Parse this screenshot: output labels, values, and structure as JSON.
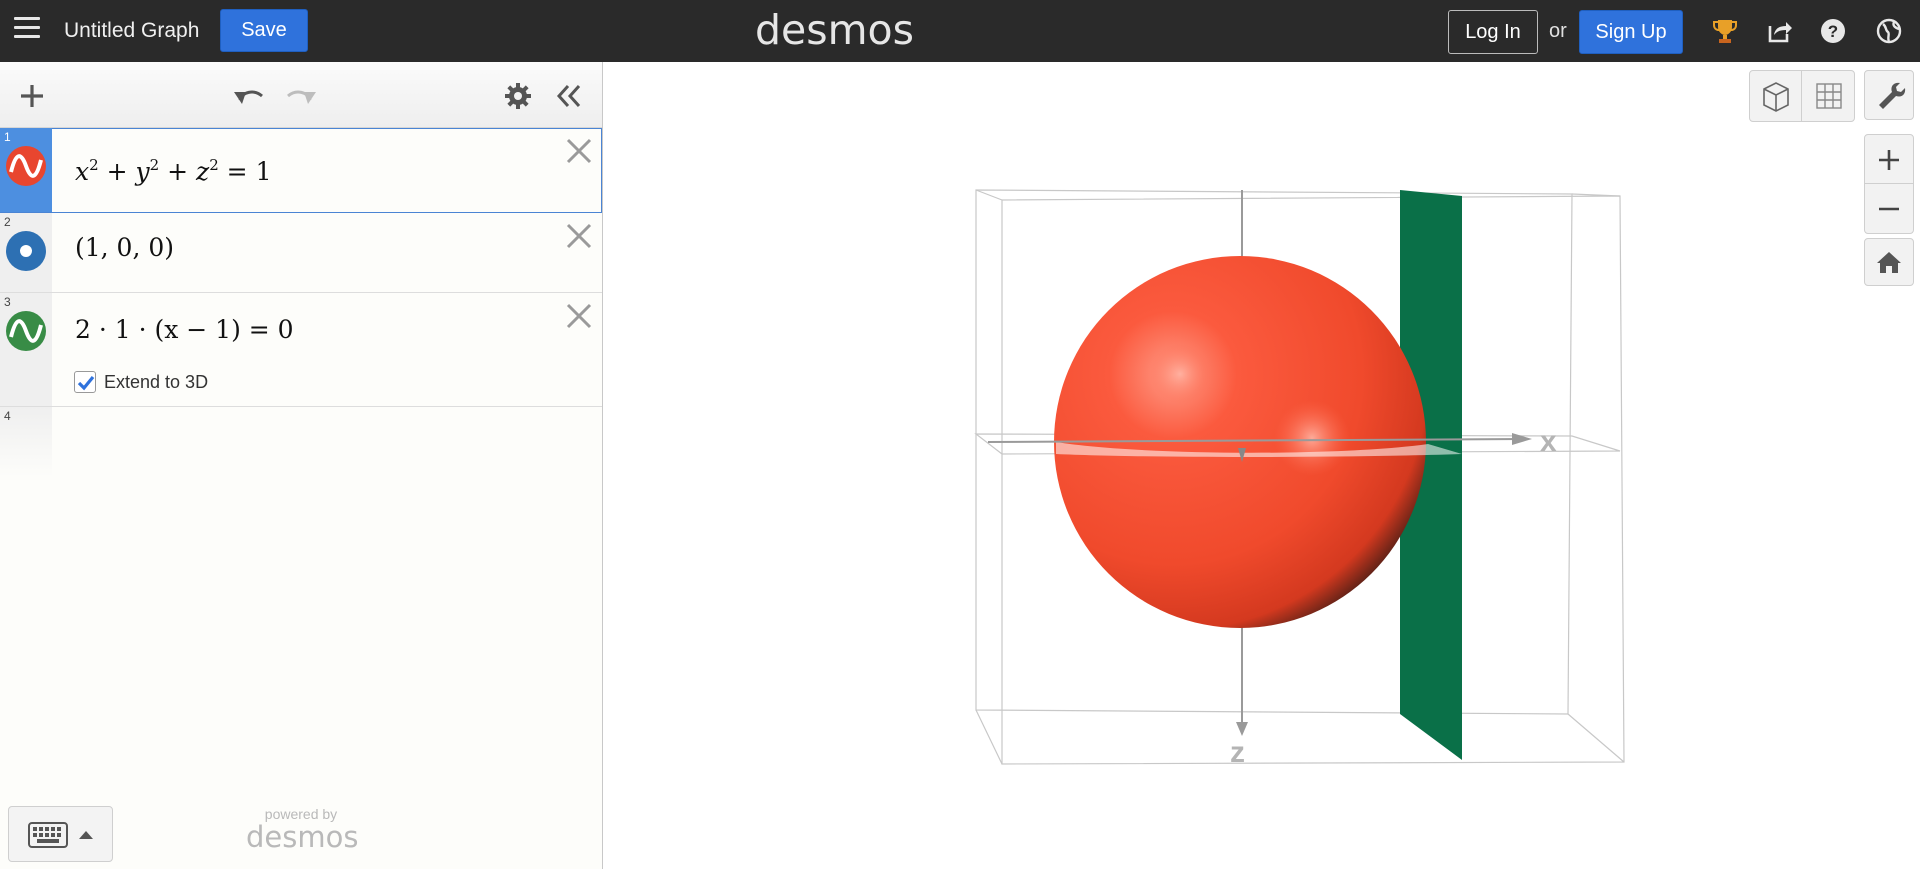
{
  "header": {
    "graph_title": "Untitled Graph",
    "save_label": "Save",
    "brand": "desmos",
    "login_label": "Log In",
    "or_text": "or",
    "signup_label": "Sign Up",
    "icons": [
      "menu-icon",
      "trophy-icon",
      "share-icon",
      "help-icon",
      "globe-icon"
    ]
  },
  "panel": {
    "toolbar_icons": [
      "add-icon",
      "undo-icon",
      "redo-icon",
      "gear-icon",
      "collapse-icon"
    ],
    "expressions": [
      {
        "index": "1",
        "latex": "x^2 + y^2 + z^2 = 1",
        "icon": "surface-icon",
        "color": "#e8462f",
        "selected": true
      },
      {
        "index": "2",
        "latex": "(1, 0, 0)",
        "icon": "point-icon",
        "color": "#2d70b3"
      },
      {
        "index": "3",
        "latex": "2 · 1 · (x − 1) = 0",
        "icon": "surface-icon",
        "color": "#388c46",
        "extend_label": "Extend to 3D",
        "extend_checked": true
      },
      {
        "index": "4",
        "latex": ""
      }
    ],
    "powered_by": "powered by",
    "powered_logo": "desmos"
  },
  "graph": {
    "axis_labels": {
      "x": "x",
      "z": "z"
    },
    "colors": {
      "sphere": "#f14a2e",
      "plane": "#0a7048",
      "box": "#c8c8c8"
    },
    "controls": [
      "cube-view-icon",
      "grid-view-icon",
      "wrench-icon",
      "zoom-in-icon",
      "zoom-out-icon",
      "home-icon"
    ]
  }
}
